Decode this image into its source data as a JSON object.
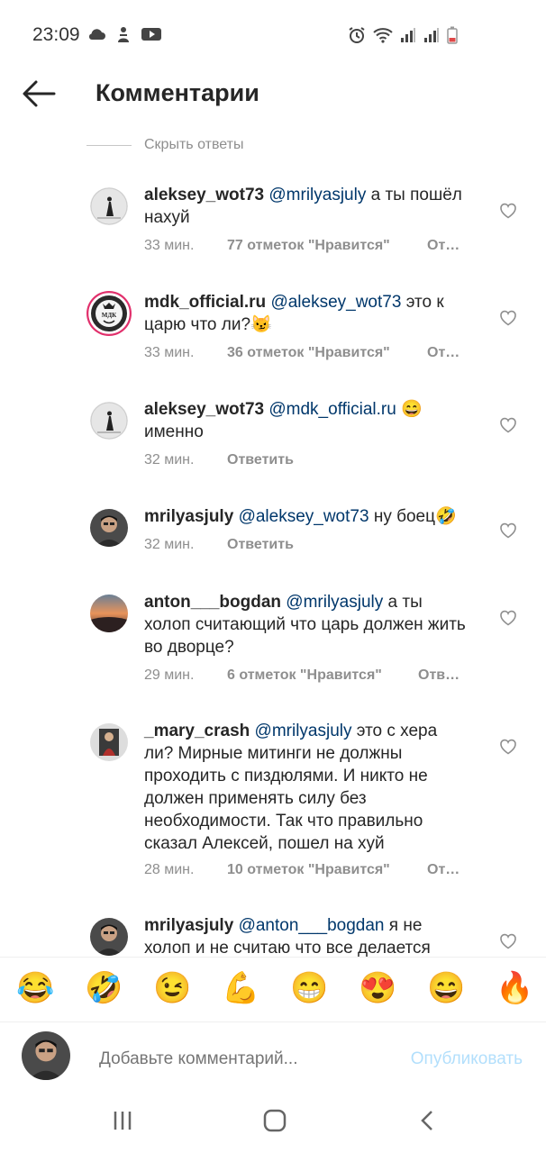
{
  "status": {
    "time": "23:09"
  },
  "header": {
    "title": "Комментарии"
  },
  "hide_replies": "Скрыть ответы",
  "comments": [
    {
      "user": "aleksey_wot73",
      "mention": "@mrilyasjuly",
      "text": " а ты пошёл нахуй",
      "time": "33 мин.",
      "likes": "77 отметок \"Нравится\"",
      "reply": "От…"
    },
    {
      "user": "mdk_official.ru",
      "mention": "@aleksey_wot73",
      "text": " это к царю что ли?😼",
      "time": "33 мин.",
      "likes": "36 отметок \"Нравится\"",
      "reply": "От…"
    },
    {
      "user": "aleksey_wot73",
      "mention": "@mdk_official.ru",
      "text": " 😄 именно",
      "time": "32 мин.",
      "likes": "",
      "reply": "Ответить"
    },
    {
      "user": "mrilyasjuly",
      "mention": "@aleksey_wot73",
      "text": " ну боец🤣",
      "time": "32 мин.",
      "likes": "",
      "reply": "Ответить"
    },
    {
      "user": "anton___bogdan",
      "mention": "@mrilyasjuly",
      "text": " а ты холоп считающий что царь должен жить во дворце?",
      "time": "29 мин.",
      "likes": "6 отметок \"Нравится\"",
      "reply": "Отв…"
    },
    {
      "user": "_mary_crash",
      "mention": "@mrilyasjuly",
      "text": " это с хера ли? Мирные митинги не должны проходить с пиздюлями. И никто не должен применять силу без необходимости. Так что правильно сказал Алексей, пошел на хуй",
      "time": "28 мин.",
      "likes": "10 отметок \"Нравится\"",
      "reply": "От…"
    },
    {
      "user": "mrilyasjuly",
      "mention": "@anton___bogdan",
      "text": " я не холоп и не считаю что все делается",
      "time": "",
      "likes": "",
      "reply": ""
    }
  ],
  "avatar_labels": {
    "mdk": "МДК"
  },
  "emojis": [
    "😂",
    "🤣",
    "😉",
    "💪",
    "😁",
    "😍",
    "😄",
    "🔥"
  ],
  "composer": {
    "placeholder": "Добавьте комментарий...",
    "publish": "Опубликовать"
  }
}
